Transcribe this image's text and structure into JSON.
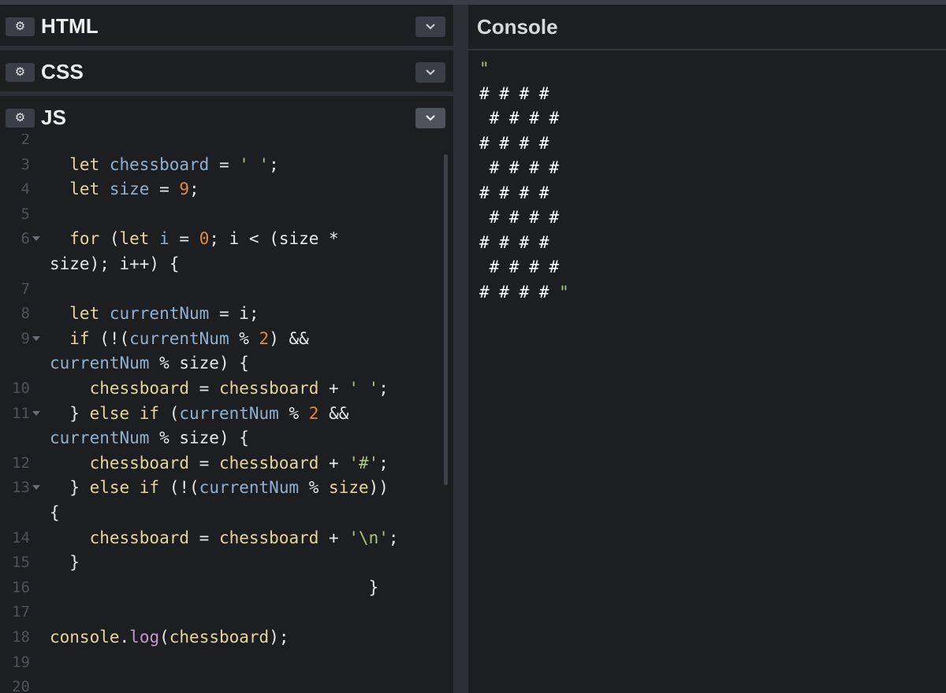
{
  "panels": {
    "html": {
      "title": "HTML"
    },
    "css": {
      "title": "CSS"
    },
    "js": {
      "title": "JS"
    }
  },
  "console": {
    "title": "Console",
    "output_open_quote": "\"",
    "output_lines": [
      "# # # #",
      " # # # #",
      "# # # #",
      " # # # #",
      "# # # #",
      " # # # #",
      "# # # #",
      " # # # #",
      "# # # #"
    ],
    "output_close_quote": "\""
  },
  "editor": {
    "lines": [
      {
        "n": "2",
        "fold": false,
        "tokens": []
      },
      {
        "n": "3",
        "fold": false,
        "tokens": [
          [
            "kw",
            "  let "
          ],
          [
            "var",
            "chessboard"
          ],
          [
            "op",
            " = "
          ],
          [
            "str",
            "' '"
          ],
          [
            "op",
            ";"
          ]
        ]
      },
      {
        "n": "4",
        "fold": false,
        "tokens": [
          [
            "kw",
            "  let "
          ],
          [
            "var",
            "size"
          ],
          [
            "op",
            " = "
          ],
          [
            "num",
            "9"
          ],
          [
            "op",
            ";"
          ]
        ]
      },
      {
        "n": "5",
        "fold": false,
        "tokens": []
      },
      {
        "n": "6",
        "fold": true,
        "tokens": [
          [
            "kw",
            "  for "
          ],
          [
            "op",
            "("
          ],
          [
            "kw",
            "let "
          ],
          [
            "var",
            "i"
          ],
          [
            "op",
            " = "
          ],
          [
            "num",
            "0"
          ],
          [
            "op",
            "; i < (size *"
          ]
        ]
      },
      {
        "n": "",
        "fold": false,
        "tokens": [
          [
            "op",
            "size); i++) {"
          ]
        ]
      },
      {
        "n": "7",
        "fold": false,
        "tokens": []
      },
      {
        "n": "8",
        "fold": false,
        "tokens": [
          [
            "kw",
            "  let "
          ],
          [
            "var",
            "currentNum"
          ],
          [
            "op",
            " = i;"
          ]
        ]
      },
      {
        "n": "9",
        "fold": true,
        "tokens": [
          [
            "kw",
            "  if "
          ],
          [
            "op",
            "(!("
          ],
          [
            "var",
            "currentNum"
          ],
          [
            "op",
            " % "
          ],
          [
            "num",
            "2"
          ],
          [
            "op",
            ") &&"
          ]
        ]
      },
      {
        "n": "",
        "fold": false,
        "tokens": [
          [
            "var",
            "currentNum"
          ],
          [
            "op",
            " % size) {"
          ]
        ]
      },
      {
        "n": "10",
        "fold": false,
        "tokens": [
          [
            "kw",
            "    chessboard"
          ],
          [
            "op",
            " = "
          ],
          [
            "kw",
            "chessboard"
          ],
          [
            "op",
            " + "
          ],
          [
            "str",
            "' '"
          ],
          [
            "op",
            ";"
          ]
        ]
      },
      {
        "n": "11",
        "fold": true,
        "tokens": [
          [
            "op",
            "  } "
          ],
          [
            "kw",
            "else if "
          ],
          [
            "op",
            "("
          ],
          [
            "var",
            "currentNum"
          ],
          [
            "op",
            " % "
          ],
          [
            "num",
            "2"
          ],
          [
            "op",
            " &&"
          ]
        ]
      },
      {
        "n": "",
        "fold": false,
        "tokens": [
          [
            "var",
            "currentNum"
          ],
          [
            "op",
            " % size) {"
          ]
        ]
      },
      {
        "n": "12",
        "fold": false,
        "tokens": [
          [
            "kw",
            "    chessboard"
          ],
          [
            "op",
            " = "
          ],
          [
            "kw",
            "chessboard"
          ],
          [
            "op",
            " + "
          ],
          [
            "str",
            "'#'"
          ],
          [
            "op",
            ";"
          ]
        ]
      },
      {
        "n": "13",
        "fold": true,
        "tokens": [
          [
            "op",
            "  } "
          ],
          [
            "kw",
            "else if "
          ],
          [
            "op",
            "(!("
          ],
          [
            "var",
            "currentNum"
          ],
          [
            "op",
            " % "
          ],
          [
            "kw",
            "size"
          ],
          [
            "op",
            "))"
          ]
        ]
      },
      {
        "n": "",
        "fold": false,
        "tokens": [
          [
            "op",
            "{"
          ]
        ]
      },
      {
        "n": "14",
        "fold": false,
        "tokens": [
          [
            "kw",
            "    chessboard"
          ],
          [
            "op",
            " = "
          ],
          [
            "kw",
            "chessboard"
          ],
          [
            "op",
            " + "
          ],
          [
            "str",
            "'\\n'"
          ],
          [
            "op",
            ";"
          ]
        ]
      },
      {
        "n": "15",
        "fold": false,
        "tokens": [
          [
            "op",
            "  }"
          ]
        ]
      },
      {
        "n": "16",
        "fold": false,
        "tokens": [
          [
            "op",
            "                                }"
          ]
        ]
      },
      {
        "n": "17",
        "fold": false,
        "tokens": []
      },
      {
        "n": "18",
        "fold": false,
        "tokens": [
          [
            "kw",
            "console"
          ],
          [
            "op",
            "."
          ],
          [
            "fn",
            "log"
          ],
          [
            "op",
            "("
          ],
          [
            "kw",
            "chessboard"
          ],
          [
            "op",
            ");"
          ]
        ]
      },
      {
        "n": "19",
        "fold": false,
        "tokens": []
      },
      {
        "n": "20",
        "fold": false,
        "tokens": []
      }
    ]
  },
  "colors": {
    "background": "#1d1e22",
    "keyword": "#e6d69a",
    "variable": "#8fb1d1",
    "number": "#e08a3c",
    "string": "#a9c77f",
    "function": "#c995c8"
  },
  "icons": {
    "settings": "gear-icon",
    "collapse": "chevron-down-icon"
  }
}
